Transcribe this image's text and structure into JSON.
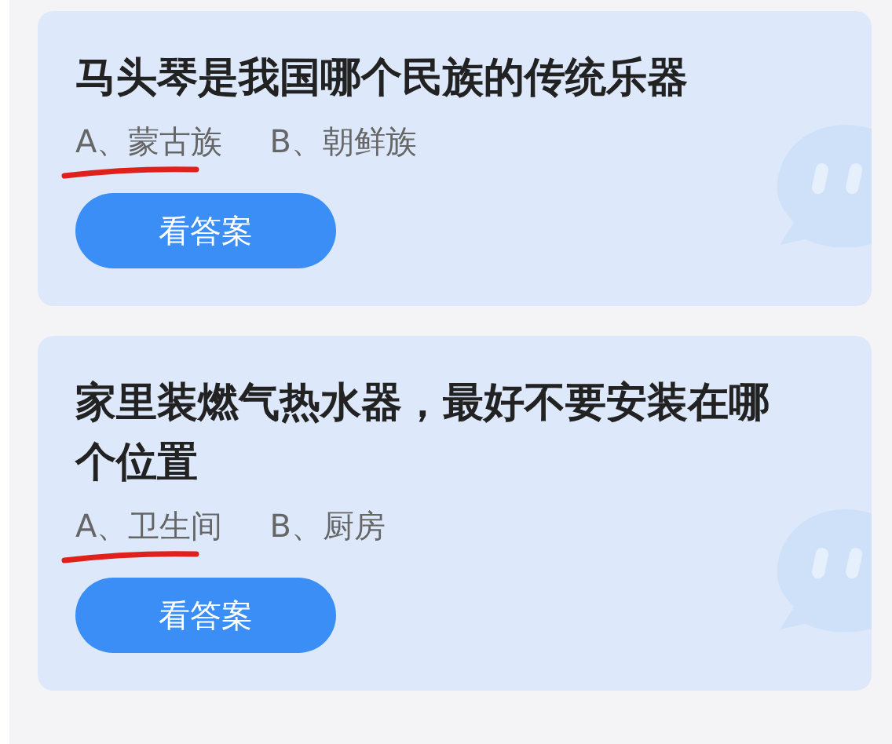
{
  "questions": [
    {
      "title": "马头琴是我国哪个民族的传统乐器",
      "options": [
        {
          "text": "A、蒙古族",
          "underlined": true
        },
        {
          "text": "B、朝鲜族",
          "underlined": false
        }
      ],
      "button": "看答案"
    },
    {
      "title": "家里装燃气热水器，最好不要安装在哪个位置",
      "options": [
        {
          "text": "A、卫生间",
          "underlined": true
        },
        {
          "text": "B、厨房",
          "underlined": false
        }
      ],
      "button": "看答案"
    }
  ]
}
